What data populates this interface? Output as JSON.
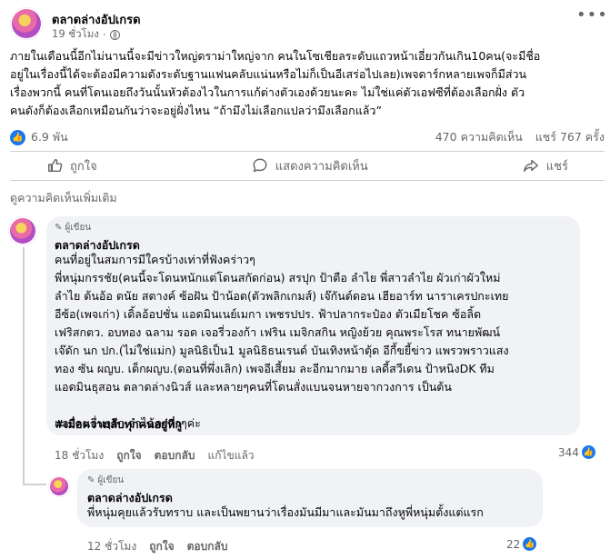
{
  "post": {
    "page_name": "ตลาดล่างอัปเกรด",
    "time": "19 ชั่วโมง",
    "text": "ภายในเดือนนี้อีกไม่นานนี้จะมีข่าวใหญ่ดราม่าใหญ่จาก คนในโซเชียลระดับแถวหน้าเอี่ยวกันเกิน10คน(จะมีชื่อ\nอยู่ในเรื่องนี้ได้จะต้องมีความดังระดับฐานแฟนคลับแน่นหรือไม่ก็เป็นอีเสร่อไปเลย)เพจดาร์กหลายเพจก็มีส่วน\nเรื่องพวกนี้ คนที่โดนเอยถึงวันนั้นหัวต้องไวในการแก้ต่างตัวเองด้วยนะคะ ไม่ใช่แค่ตัวเอฟซีที่ต้องเลือกฝั่ง ตัว\nคนดังก็ต้องเลือกเหมือนกันว่าจะอยู่ฝั่งไหน “ถ้ามึงไม่เลือกแปลว่ามึงเลือกแล้ว”",
    "reactions": "6.9 พัน",
    "comments_count": "470 ความคิดเห็น",
    "shares_count": "แชร์ 767 ครั้ง"
  },
  "actions": {
    "like": "ถูกใจ",
    "comment": "แสดงความคิดเห็น",
    "share": "แชร์"
  },
  "more_comments": "ดูความคิดเห็นเพิ่มเติม",
  "comment1": {
    "badge": "ผู้เขียน",
    "name": "ตลาดล่างอัปเกรด",
    "text": "คนที่อยู่ในสมการมีใครบ้างเท่าที่ฟังคร่าวๆ\nพี่หนุ่มกรรชัย(คนนี้จะโดนหนักแต่โดนสกัดก่อน) สรปุก ป้าตือ ลำไย พี่สาวลำไย ผัวเก่าผัวใหม่\nลำไย ต้นอ้อ ตนัย สตางค์ ซ้อฝัน ป้าน้อต(ตัวพลิกเกมส์) เจ๊กันต์ดอน เฮียอาร์ท นาราเครปกะเทย\nอีซ้อ(เพจเก่า) เดิ้ลอ้อปชั่น แอดมินเนย์เมกา เพชรปปร. ฟ้าปลากระป๋อง ตัวเมียโชค ซ้อลิ้ด\nเฟริสกตว. อบทอง ฉลาม รอด เจอรี่วองก้า เฟริน เมจิกสกิน หญิงย้วย คุณพระโรส ทนายพัฒน์\nเจ๊ดัก นก ปก.(ไม่ใช่แม่ก) มูลนิธิเป็น1 มูลนิธิธนเรนด์ บันเทิงหน้าตุ้ด อีกี้ขยี้ข่าว แพรวพราวแสง\nทอง ซัน ผญบ. เต็กผญบ.(ตอนที่พึ่งเลิก) เพจอีเสี้ยม ละอีกมากมาย เลดี้สวีเดน ป้าหนิงDK ทีม\nแอดมินธุสอน ตลาดล่างนิวส์ และหลายๆคนที่โดนสั่งแบนจนหายจากวงการ เป็นต้น\n\nและคนอื่นๆอีก จำได้คร่าวๆค่ะ",
    "hashtag": "#เมื่อความลับทุกคนอยู่ที่กู",
    "time": "18 ชั่วโมง",
    "like": "ถูกใจ",
    "reply": "ตอบกลับ",
    "edited": "แก้ไขแล้ว",
    "likes": "344"
  },
  "comment2": {
    "badge": "ผู้เขียน",
    "name": "ตลาดล่างอัปเกรด",
    "text": "พี่หนุ่มคุยแล้วรับทราบ และเป็นพยานว่าเรื่องมันมีมาและมันมาถึงหูพี่หนุ่มตั้งแต่แรก",
    "time": "12 ชั่วโมง",
    "like": "ถูกใจ",
    "reply": "ตอบกลับ",
    "likes": "22"
  },
  "colors": {
    "accent": "#1877f2",
    "muted": "#65676b",
    "bubble": "#f0f2f5"
  }
}
